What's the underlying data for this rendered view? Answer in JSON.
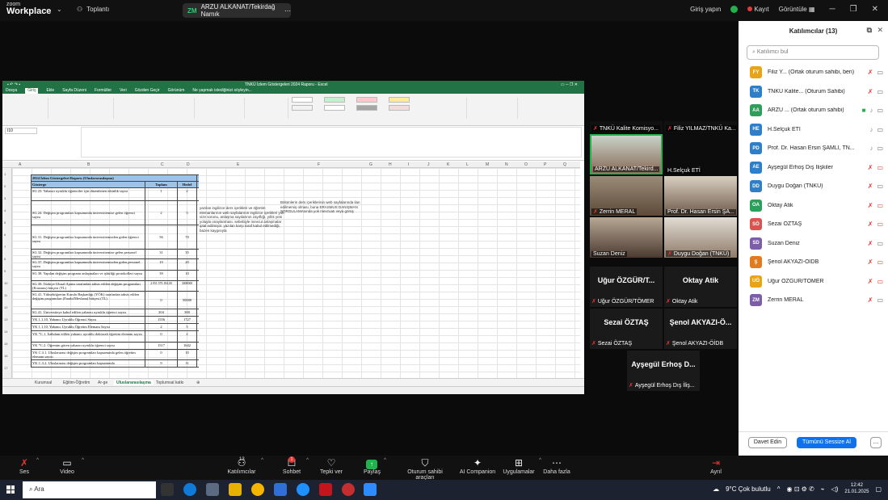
{
  "zoom": {
    "logo_line1": "zoom",
    "logo_line2": "Workplace",
    "meetings_label": "Toplantı",
    "share_pill": "ARZU ALKANAT/Tekirdağ Namık",
    "sign_in": "Giriş yapın",
    "record": "Kayıt",
    "view": "Görüntüle"
  },
  "excel": {
    "title": "TNKÜ İzlem Göstergeleri 2024 Raporu - Excel",
    "tabs": [
      "Dosya",
      "Giriş",
      "Ekle",
      "Sayfa Düzeni",
      "Formüller",
      "Veri",
      "Gözden Geçir",
      "Görünüm",
      "Ne yapmak istediğinizi söyleyin..."
    ],
    "namebox": "I10",
    "columns": [
      "A",
      "B",
      "C",
      "D",
      "E",
      "F",
      "G",
      "H",
      "I",
      "J",
      "K",
      "L",
      "M",
      "N",
      "O",
      "P",
      "Q"
    ],
    "row_numbers": [
      "1",
      "2",
      "3",
      "4",
      "5",
      "6",
      "7",
      "8",
      "9",
      "10",
      "11",
      "12",
      "13",
      "14",
      "15",
      "16",
      "17"
    ],
    "table_title": "2024 İzlem Göstergeleri Raporu (Uluslararasılaşma)",
    "header": {
      "gosterge": "Gösterge",
      "toplam": "Toplam",
      "hedef": "Hedef"
    },
    "rows": [
      {
        "g": "SG 23. Yabancı uyruklu öğrenciler için düzenlenen etkinlik sayısı",
        "t": "1",
        "h": "2"
      },
      {
        "g": "SG 24. Değişim programları kapsamında üniversitemize gelen öğrenci sayısı",
        "t": "2",
        "h": "5"
      },
      {
        "g": "SG 31. Değişim programları kapsamında üniversitemizden giden öğrenci sayısı",
        "t": "56",
        "h": "70"
      },
      {
        "g": "SG 32. Değişim programları kapsamında üniversitemize gelen personel sayısı",
        "t": "31",
        "h": "35"
      },
      {
        "g": "SG 37. Değişim programları kapsamında üniversitemizden giden personel sayısı",
        "t": "19",
        "h": "20"
      },
      {
        "g": "SG 38. Yapılan değişim programı anlaşmaları ve işbirliği protokolleri sayısı",
        "t": "39",
        "h": "10"
      },
      {
        "g": "SG 39. Türkiye Ulusal Ajansı tarafından tahsis edilen değişim programları (Erasmus) bütçesi (TL)",
        "t": "2.951.570.184,00",
        "h": "3000000"
      },
      {
        "g": "SG 41. Yükseköğretim Kurulu Başkanlığı (YÖK) tarafından tahsis edilen değişim programları (Farabi/Mevlana) bütçesi (TL)",
        "t": "0",
        "h": "50000"
      },
      {
        "g": "SG 41. Üniversiteye kabul edilen yabancı uyruklu öğrenci sayısı",
        "t": "204",
        "h": "300"
      },
      {
        "g": "YK 1.1.10. Yabancı Uyruklu Öğrenci Sayısı",
        "t": "1556",
        "h": "1727"
      },
      {
        "g": "YK 1.1.10. Yabancı Uyruklu Öğretim Elemanı Sayısı",
        "t": "2",
        "h": "5"
      },
      {
        "g": "YK *C.1. İstihdam edilen yabancı uyruklu doktoralı öğretim elemanı sayısı",
        "t": "0",
        "h": "2"
      },
      {
        "g": "YK *C.2. Öğrenim gören yabancı uyruklu öğrenci sayısı",
        "t": "1517",
        "h": "1642"
      },
      {
        "g": "YK C.3.1. Uluslararası değişim programları kapsamında gelen öğretim elemanı sayısı",
        "t": "0",
        "h": "10"
      },
      {
        "g": "YK C.3.2. Uluslararası değişim programları kapsamında",
        "t": "9",
        "h": "11"
      }
    ],
    "notes_e": "yazılan ingilizce ders içerikleri ve öğretim elemanlarının web sayfalarının ingilizce içerikleri yok. vize sorunu, anlaşma sayılarının zayıflığı, yıllık yeni yoluyla onaylanması. sebebiyle mevcut anlaşmalar iptal edilmiştir. yazılan karşı taraf kabul edilmediği, bazen kaygısıyla",
    "notes_f": "Bölümlerin ders içeriklerinin web sayfalarında ilan edilmemiş olması, buna ERASMUS DANIŞMAN SORGULAMAsında yok mevzuatı veya görüş",
    "sheet_tabs": [
      "Kurumsal",
      "Eğitim-Öğretim",
      "Ar-ge",
      "Uluslararasılaşma",
      "Toplumsal katkı"
    ]
  },
  "gallery": {
    "tiles": [
      {
        "name": "TNKÜ Kalite Komisyo..."
      },
      {
        "name": "Filiz YILMAZ/TNKÜ Ka..."
      },
      {
        "name": "ARZU ALKANAT/Tekird..."
      },
      {
        "name": "H.Selçuk ETİ"
      },
      {
        "name": "Zerrin MERAL"
      },
      {
        "name": "Prof. Dr. Hasan Ersin ŞA..."
      },
      {
        "name": "Suzan Deniz"
      },
      {
        "name": "Duygu Doğan (TNKÜ)"
      }
    ],
    "name_tiles": [
      {
        "big": "Uğur ÖZGÜR/T...",
        "name": "Uğur ÖZGÜR/TÖMER"
      },
      {
        "big": "Oktay Atik",
        "name": "Oktay Atik"
      },
      {
        "big": "Sezai ÖZTAŞ",
        "name": "Sezai ÖZTAŞ"
      },
      {
        "big": "Şenol AKYAZI-Ö...",
        "name": "Şenol AKYAZI-ÖİDB"
      },
      {
        "big": "Ayşegül Erhoş D...",
        "name": "Ayşegül Erhoş Dış İliş..."
      }
    ]
  },
  "participants": {
    "title": "Katılımcılar (13)",
    "search_placeholder": "Katılımcı bul",
    "list": [
      {
        "initials": "FY",
        "color": "#e8a317",
        "name": "Filiz Y... (Ortak oturum sahibi, ben)"
      },
      {
        "initials": "TK",
        "color": "#2f7fc8",
        "name": "TNKÜ Kalite... (Oturum Sahibi)"
      },
      {
        "initials": "AA",
        "color": "#2e9e5b",
        "name": "ARZU ... (Ortak oturum sahibi)"
      },
      {
        "initials": "HE",
        "color": "#2f7fc8",
        "name": "H.Selçuk ETİ"
      },
      {
        "initials": "PD",
        "color": "#2f7fc8",
        "name": "Prof. Dr. Hasan Ersin ŞAMLI, TN..."
      },
      {
        "initials": "AE",
        "color": "#2f7fc8",
        "name": "Ayşegül Erhoş Dış İlişkiler"
      },
      {
        "initials": "DD",
        "color": "#2f7fc8",
        "name": "Duygu Doğan (TNKÜ)"
      },
      {
        "initials": "OA",
        "color": "#2e9e5b",
        "name": "Oktay Atik"
      },
      {
        "initials": "SÖ",
        "color": "#d9534f",
        "name": "Sezai ÖZTAŞ"
      },
      {
        "initials": "SD",
        "color": "#7b5ea7",
        "name": "Suzan Deniz"
      },
      {
        "initials": "Ş",
        "color": "#e07b1f",
        "name": "Şenol AKYAZI-ÖİDB"
      },
      {
        "initials": "UÖ",
        "color": "#e8a317",
        "name": "Uğur ÖZGÜR/TÖMER"
      },
      {
        "initials": "ZM",
        "color": "#7b5ea7",
        "name": "Zerrin MERAL"
      }
    ],
    "invite": "Davet Edin",
    "mute_all": "Tümünü Sessize Al",
    "more": "..."
  },
  "toolbar": {
    "audio": "Ses",
    "video": "Video",
    "participants": "Katılımcılar",
    "participants_count": "13",
    "chat": "Sohbet",
    "chat_badge": "1",
    "react": "Tepki ver",
    "share": "Paylaş",
    "host_tools": "Oturum sahibi araçları",
    "ai": "AI Companion",
    "apps": "Uygulamalar",
    "more": "Daha fazla",
    "leave": "Ayrıl"
  },
  "taskbar": {
    "search": "Ara",
    "weather": "9°C Çok bulutlu",
    "time": "12:42",
    "date": "21.01.2025"
  }
}
